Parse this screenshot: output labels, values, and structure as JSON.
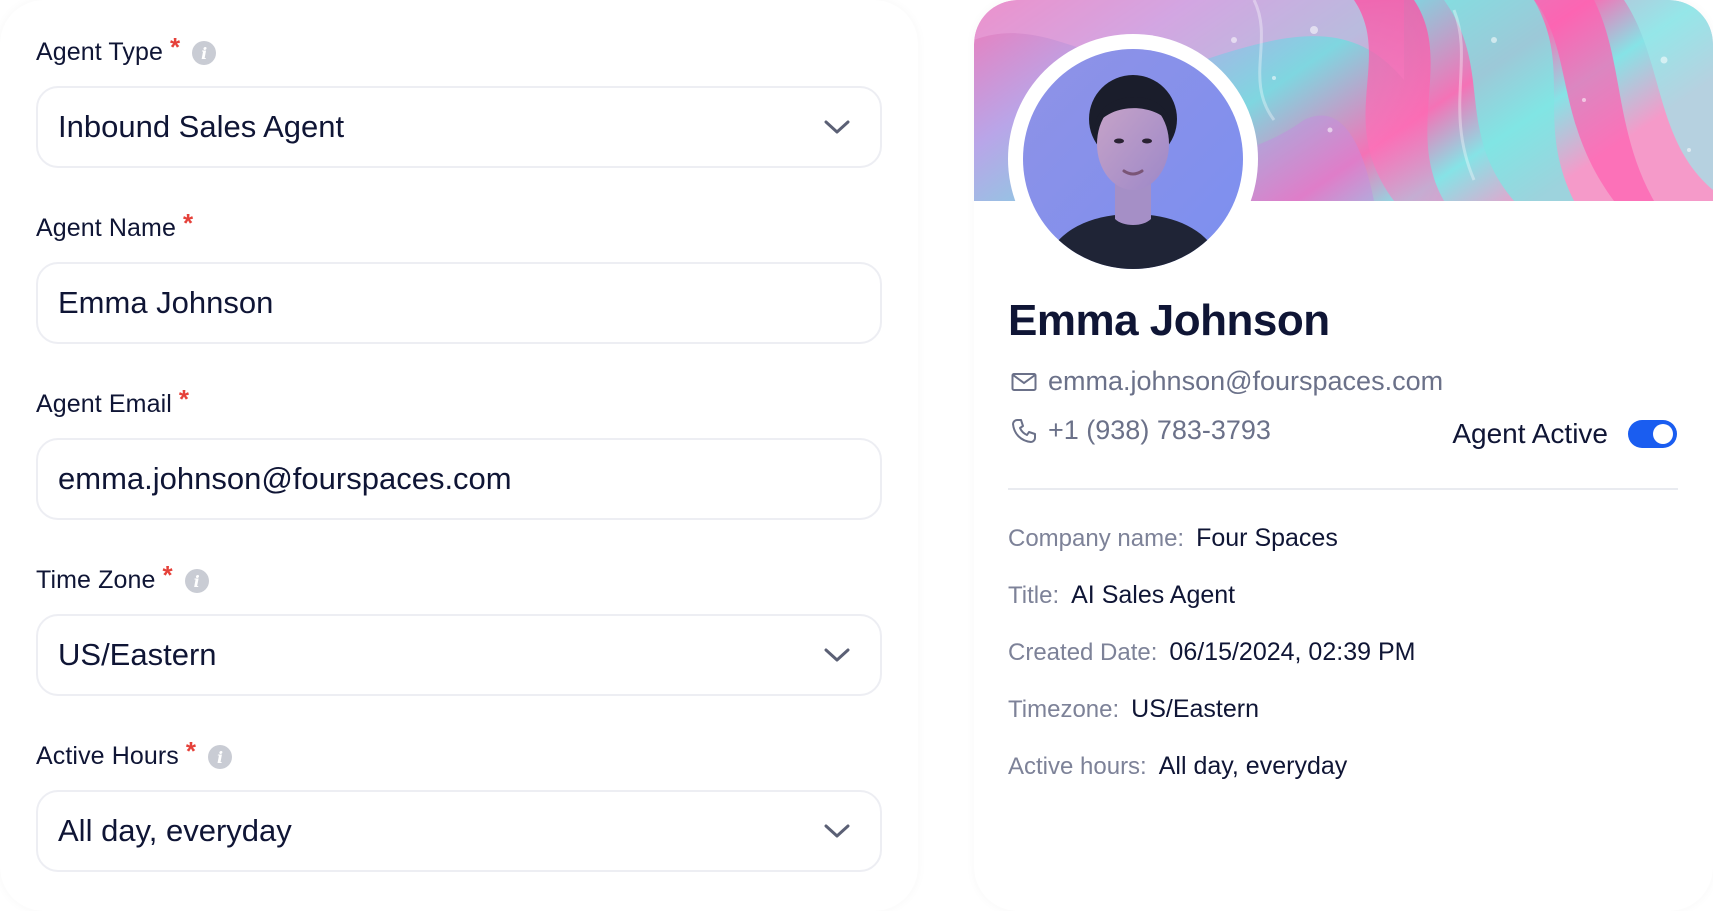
{
  "form": {
    "fields": [
      {
        "label": "Agent Type",
        "required_mark": "*",
        "has_info": true,
        "value": "Inbound Sales Agent",
        "kind": "select"
      },
      {
        "label": "Agent Name",
        "required_mark": "*",
        "has_info": false,
        "value": "Emma Johnson",
        "kind": "text"
      },
      {
        "label": "Agent Email",
        "required_mark": "*",
        "has_info": false,
        "value": "emma.johnson@fourspaces.com",
        "kind": "text"
      },
      {
        "label": "Time Zone",
        "required_mark": "*",
        "has_info": true,
        "value": "US/Eastern",
        "kind": "select"
      },
      {
        "label": "Active Hours",
        "required_mark": "*",
        "has_info": true,
        "value": "All day, everyday",
        "kind": "select"
      }
    ],
    "info_glyph": "i",
    "icons": {
      "info": "info-icon",
      "dropdown": "chevron-down-icon"
    }
  },
  "profile": {
    "name": "Emma Johnson",
    "email": "emma.johnson@fourspaces.com",
    "phone": "+1 (938) 783-3793",
    "active_label": "Agent Active",
    "active": true,
    "icons": {
      "email": "mail-icon",
      "phone": "phone-icon"
    },
    "details": [
      {
        "label": "Company name:",
        "value": "Four Spaces"
      },
      {
        "label": "Title:",
        "value": "AI Sales Agent"
      },
      {
        "label": "Created Date:",
        "value": "06/15/2024, 02:39 PM"
      },
      {
        "label": "Timezone:",
        "value": "US/Eastern"
      },
      {
        "label": "Active hours:",
        "value": "All day, everyday"
      }
    ]
  },
  "colors": {
    "text_primary": "#0f1535",
    "text_secondary": "#6b7189",
    "required": "#e5413a",
    "toggle_on": "#1a5df0",
    "border": "#edeef3"
  }
}
